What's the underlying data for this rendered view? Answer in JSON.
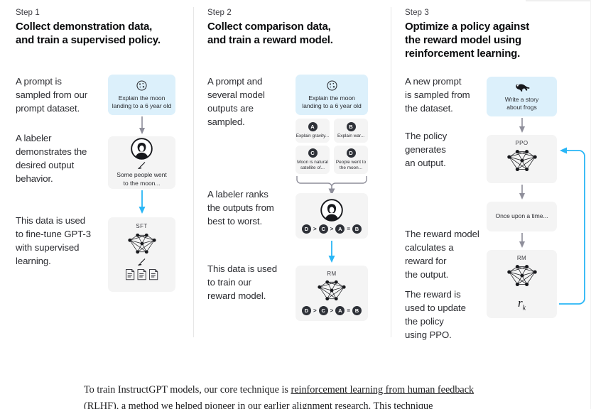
{
  "steps": [
    {
      "label": "Step 1",
      "title": "Collect demonstration data,\nand train a supervised policy.",
      "paragraphs": [
        "A prompt is\nsampled from our\nprompt dataset.",
        "A labeler\ndemonstrates the\ndesired output\nbehavior.",
        "This data is used\nto fine-tune GPT-3\nwith supervised\nlearning."
      ],
      "prompt_box": {
        "text": "Explain the moon\nlanding to a 6 year old",
        "icon": "moon-icon"
      },
      "labeler_box": {
        "text": "Some people went\nto the moon...",
        "icon": "labeler-avatar-icon"
      },
      "model_box": {
        "label": "SFT",
        "icon": "neural-network-icon",
        "docs_icon": "documents-icon"
      }
    },
    {
      "label": "Step 2",
      "title": "Collect comparison data,\nand train a reward model.",
      "paragraphs": [
        "A prompt and\nseveral model\noutputs are\nsampled.",
        "A labeler ranks\nthe outputs from\nbest to worst.",
        "This data is used\nto train our\nreward model."
      ],
      "prompt_box": {
        "text": "Explain the moon\nlanding to a 6 year old",
        "icon": "moon-icon"
      },
      "options": [
        {
          "badge": "A",
          "text": "Explain gravity..."
        },
        {
          "badge": "B",
          "text": "Explain war..."
        },
        {
          "badge": "C",
          "text": "Moon is natural\nsatellite of..."
        },
        {
          "badge": "D",
          "text": "People went to\nthe moon..."
        }
      ],
      "ranking": [
        "D",
        ">",
        "C",
        ">",
        "A",
        "=",
        "B"
      ],
      "labeler_box": {
        "icon": "labeler-avatar-icon"
      },
      "model_box": {
        "label": "RM",
        "icon": "neural-network-icon"
      }
    },
    {
      "label": "Step 3",
      "title": "Optimize a policy against\nthe reward model using\nreinforcement learning.",
      "paragraphs": [
        "A new prompt\nis sampled from\nthe dataset.",
        "The policy\ngenerates\nan output.",
        "The reward model\ncalculates a\nreward for\nthe output.",
        "The reward is\nused to update\nthe policy\nusing PPO."
      ],
      "prompt_box": {
        "text": "Write a story\nabout frogs",
        "icon": "frog-icon"
      },
      "policy_box": {
        "label": "PPO",
        "icon": "neural-network-icon"
      },
      "output_box": {
        "text": "Once upon a time..."
      },
      "reward_model_box": {
        "label": "RM",
        "icon": "neural-network-icon"
      },
      "reward_box": {
        "symbol": "r",
        "subscript": "k"
      }
    }
  ],
  "footer": {
    "before": "To train InstructGPT models, our core technique is ",
    "link": "reinforcement learning from human feedback (RLHF)",
    "after": ", a method we helped pioneer in our earlier alignment research. This technique"
  },
  "colors": {
    "prompt_box_bg": "#dcf0fb",
    "grey_box_bg": "#f4f4f4",
    "badge_bg": "#2e3138",
    "arrow_grey": "#8e8e9a",
    "arrow_blue": "#29b6f6",
    "divider": "#e6e6e6"
  }
}
